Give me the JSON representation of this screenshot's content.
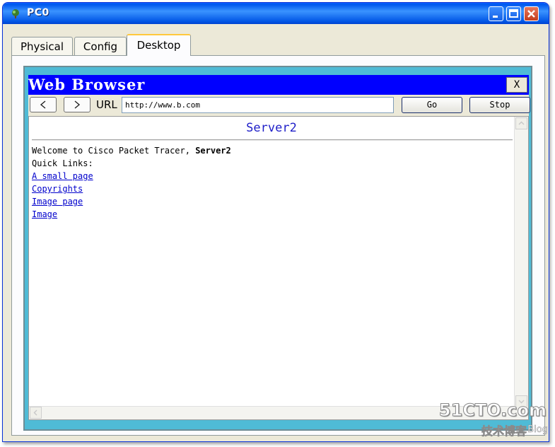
{
  "window": {
    "title": "PC0",
    "controls": {
      "minimize": "minimize",
      "maximize": "maximize",
      "close": "close"
    }
  },
  "tabs": [
    {
      "label": "Physical",
      "active": false
    },
    {
      "label": "Config",
      "active": false
    },
    {
      "label": "Desktop",
      "active": true
    }
  ],
  "browser": {
    "title": "Web Browser",
    "close_label": "X",
    "url_label": "URL",
    "url_value": "http://www.b.com",
    "go_label": "Go",
    "stop_label": "Stop"
  },
  "page": {
    "heading": "Server2",
    "welcome_text": "Welcome to Cisco Packet Tracer, ",
    "welcome_bold": "Server2",
    "quick_links_label": "Quick Links:",
    "links": [
      "A small page",
      "Copyrights",
      "Image page",
      "Image"
    ]
  },
  "watermark": {
    "site": "51CTO.com",
    "subtitle": "技术博客",
    "blog": "Blog"
  },
  "colors": {
    "titlebar": "#0058ee",
    "browser_title_bar": "#0000ff",
    "desktop_frame": "#4fbbd6",
    "link": "#0000cc"
  }
}
